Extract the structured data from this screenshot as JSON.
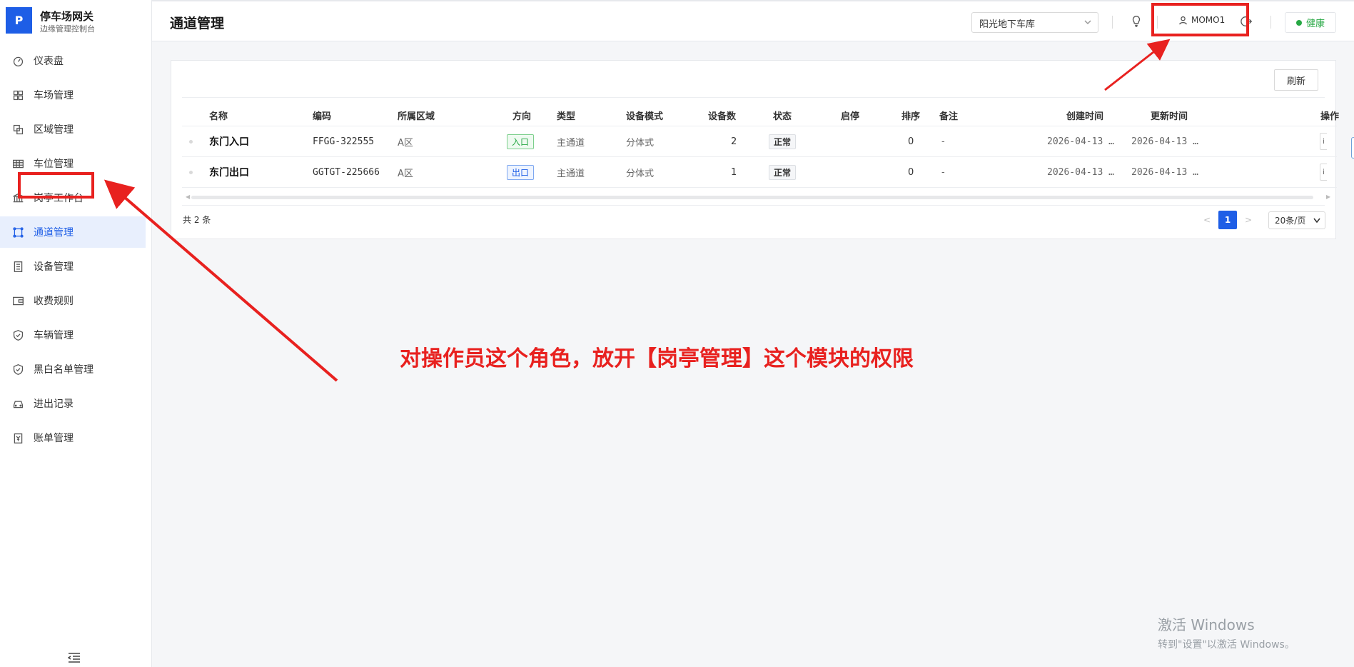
{
  "brand": {
    "logo": "P",
    "title": "停车场网关",
    "subtitle": "边缘管理控制台"
  },
  "sidebar": {
    "items": [
      {
        "label": "仪表盘",
        "icon": "dashboard-icon"
      },
      {
        "label": "车场管理",
        "icon": "grid-icon"
      },
      {
        "label": "区域管理",
        "icon": "layers-icon"
      },
      {
        "label": "车位管理",
        "icon": "table-icon"
      },
      {
        "label": "岗亭工作台",
        "icon": "building-icon"
      },
      {
        "label": "通道管理",
        "icon": "channel-icon",
        "active": true
      },
      {
        "label": "设备管理",
        "icon": "device-icon"
      },
      {
        "label": "收费规则",
        "icon": "wallet-icon"
      },
      {
        "label": "车辆管理",
        "icon": "shield-icon"
      },
      {
        "label": "黑白名单管理",
        "icon": "shield-check-icon"
      },
      {
        "label": "进出记录",
        "icon": "car-icon"
      },
      {
        "label": "账单管理",
        "icon": "bill-icon"
      }
    ]
  },
  "header": {
    "title": "通道管理",
    "lot_select": "阳光地下车库",
    "user": "MOMO1",
    "health": "健康"
  },
  "toolbar": {
    "refresh": "刷新"
  },
  "table": {
    "columns": [
      "名称",
      "编码",
      "所属区域",
      "方向",
      "类型",
      "设备模式",
      "设备数",
      "状态",
      "启停",
      "排序",
      "备注",
      "创建时间",
      "更新时间",
      "操作"
    ],
    "rows": [
      {
        "name": "东门入口",
        "code": "FFGG-322555",
        "area": "A区",
        "direction": "入口",
        "type": "主通道",
        "mode": "分体式",
        "devices": "2",
        "status": "正常",
        "sort": "0",
        "remark": "-",
        "created": "2026-04-13 …",
        "updated": "2026-04-13 …",
        "op": "i"
      },
      {
        "name": "东门出口",
        "code": "GGTGT-225666",
        "area": "A区",
        "direction": "出口",
        "type": "主通道",
        "mode": "分体式",
        "devices": "1",
        "status": "正常",
        "sort": "0",
        "remark": "-",
        "created": "2026-04-13 …",
        "updated": "2026-04-13 …",
        "op": "i"
      }
    ]
  },
  "pagination": {
    "total": "共 2 条",
    "current": "1",
    "page_size": "20条/页",
    "prev": "<",
    "next": ">"
  },
  "annotation": {
    "text": "对操作员这个角色，放开【岗亭管理】这个模块的权限",
    "color": "#e8211f"
  },
  "watermark": {
    "line1": "激活 Windows",
    "line2": "转到\"设置\"以激活 Windows。"
  },
  "colors": {
    "accent": "#1e5ee6",
    "success": "#27a844",
    "annotation": "#e8211f"
  }
}
